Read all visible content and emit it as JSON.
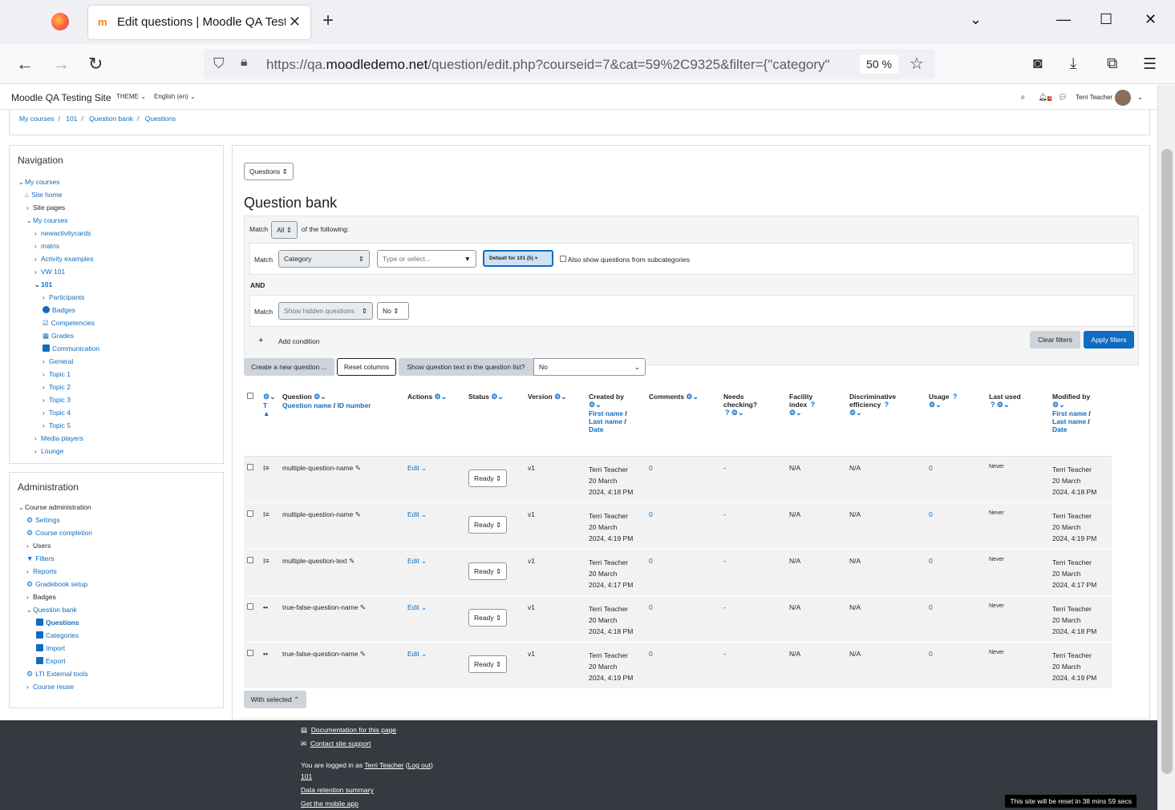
{
  "browser": {
    "tab_title": "Edit questions | Moodle QA Testing Site",
    "url_prefix": "https://qa.",
    "url_domain": "moodledemo.net",
    "url_rest": "/question/edit.php?courseid=7&cat=59%2C9325&filter={\"category\"",
    "zoom": "50 %"
  },
  "topbar": {
    "site_name": "Moodle QA Testing Site",
    "theme": "THEME",
    "language": "English (en)",
    "user": "Terri Teacher",
    "notif_count": "3"
  },
  "breadcrumb": [
    "My courses",
    "101",
    "Question bank",
    "Questions"
  ],
  "navigation": {
    "title": "Navigation",
    "items": [
      "My courses",
      "Site home",
      "Site pages",
      "My courses",
      "newactivitycards",
      "matrix",
      "Activity examples",
      "VW 101",
      "101",
      "Participants",
      "Badges",
      "Competencies",
      "Grades",
      "Communication",
      "General",
      "Topic 1",
      "Topic 2",
      "Topic 3",
      "Topic 4",
      "Topic 5",
      "Media players",
      "Lounge"
    ]
  },
  "administration": {
    "title": "Administration",
    "items": [
      "Course administration",
      "Settings",
      "Course completion",
      "Users",
      "Filters",
      "Reports",
      "Gradebook setup",
      "Badges",
      "Question bank",
      "Questions",
      "Categories",
      "Import",
      "Export",
      "LTI External tools",
      "Course reuse"
    ]
  },
  "main": {
    "page_select": "Questions",
    "heading": "Question bank",
    "filter": {
      "match_label": "Match",
      "match_value": "All",
      "of_following": "of the following:",
      "cond1_field": "Category",
      "cond1_placeholder": "Type or select...",
      "cond1_chip": "Default for 101 (5)",
      "subcats_label": "Also show questions from subcategories",
      "and_label": "AND",
      "cond2_field": "Show hidden questions",
      "cond2_value": "No",
      "add_condition": "Add condition",
      "clear": "Clear filters",
      "apply": "Apply filters"
    },
    "actions": {
      "create": "Create a new question ...",
      "reset": "Reset columns",
      "show_text_label": "Show question text in the question list?",
      "show_text_value": "No"
    },
    "columns": {
      "type": "T",
      "question": "Question",
      "question_name": "Question name",
      "id_number": "ID number",
      "actions": "Actions",
      "status": "Status",
      "version": "Version",
      "created_by": "Created by",
      "first_name": "First name",
      "last_name": "Last name",
      "date": "Date",
      "comments": "Comments",
      "needs": "Needs",
      "checking": "checking?",
      "facility": "Facility",
      "index": "index",
      "discriminative": "Discriminative",
      "efficiency": "efficiency",
      "usage": "Usage",
      "last_used": "Last used",
      "modified_by": "Modified by"
    },
    "rows": [
      {
        "icon": "⁝≡",
        "name": "multiple-question-name",
        "edit": "Edit",
        "status": "Ready",
        "version": "v1",
        "creator": "Terri Teacher",
        "cdate1": "20 March",
        "cdate2": "2024, 4:18 PM",
        "comments": "0",
        "needs": "-",
        "facility": "N/A",
        "discr": "N/A",
        "usage": "0",
        "last_used": "Never",
        "modifier": "Terri Teacher",
        "mdate1": "20 March",
        "mdate2": "2024, 4:18 PM"
      },
      {
        "icon": "⁝≡",
        "name": "multiple-question-name",
        "edit": "Edit",
        "status": "Ready",
        "version": "v1",
        "creator": "Terri Teacher",
        "cdate1": "20 March",
        "cdate2": "2024, 4:19 PM",
        "comments": "0",
        "needs": "-",
        "facility": "N/A",
        "discr": "N/A",
        "usage": "0",
        "last_used": "Never",
        "modifier": "Terri Teacher",
        "mdate1": "20 March",
        "mdate2": "2024, 4:19 PM"
      },
      {
        "icon": "⁝≡",
        "name": "multiple-question-text",
        "edit": "Edit",
        "status": "Ready",
        "version": "v1",
        "creator": "Terri Teacher",
        "cdate1": "20 March",
        "cdate2": "2024, 4:17 PM",
        "comments": "0",
        "needs": "-",
        "facility": "N/A",
        "discr": "N/A",
        "usage": "0",
        "last_used": "Never",
        "modifier": "Terri Teacher",
        "mdate1": "20 March",
        "mdate2": "2024, 4:17 PM"
      },
      {
        "icon": "••",
        "name": "true-false-question-name",
        "edit": "Edit",
        "status": "Ready",
        "version": "v1",
        "creator": "Terri Teacher",
        "cdate1": "20 March",
        "cdate2": "2024, 4:18 PM",
        "comments": "0",
        "needs": "-",
        "facility": "N/A",
        "discr": "N/A",
        "usage": "0",
        "last_used": "Never",
        "modifier": "Terri Teacher",
        "mdate1": "20 March",
        "mdate2": "2024, 4:18 PM"
      },
      {
        "icon": "••",
        "name": "true-false-question-name",
        "edit": "Edit",
        "status": "Ready",
        "version": "v1",
        "creator": "Terri Teacher",
        "cdate1": "20 March",
        "cdate2": "2024, 4:19 PM",
        "comments": "0",
        "needs": "-",
        "facility": "N/A",
        "discr": "N/A",
        "usage": "0",
        "last_used": "Never",
        "modifier": "Terri Teacher",
        "mdate1": "20 March",
        "mdate2": "2024, 4:19 PM"
      }
    ],
    "with_selected": "With selected"
  },
  "footer": {
    "docs": "Documentation for this page",
    "contact": "Contact site support",
    "logged_in_prefix": "You are logged in as",
    "logged_in_user": "Terri Teacher",
    "logout": "Log out",
    "course": "101",
    "retention": "Data retention summary",
    "mobile": "Get the mobile app",
    "reset_note": "This site will be reset in 38 mins 59 secs"
  }
}
